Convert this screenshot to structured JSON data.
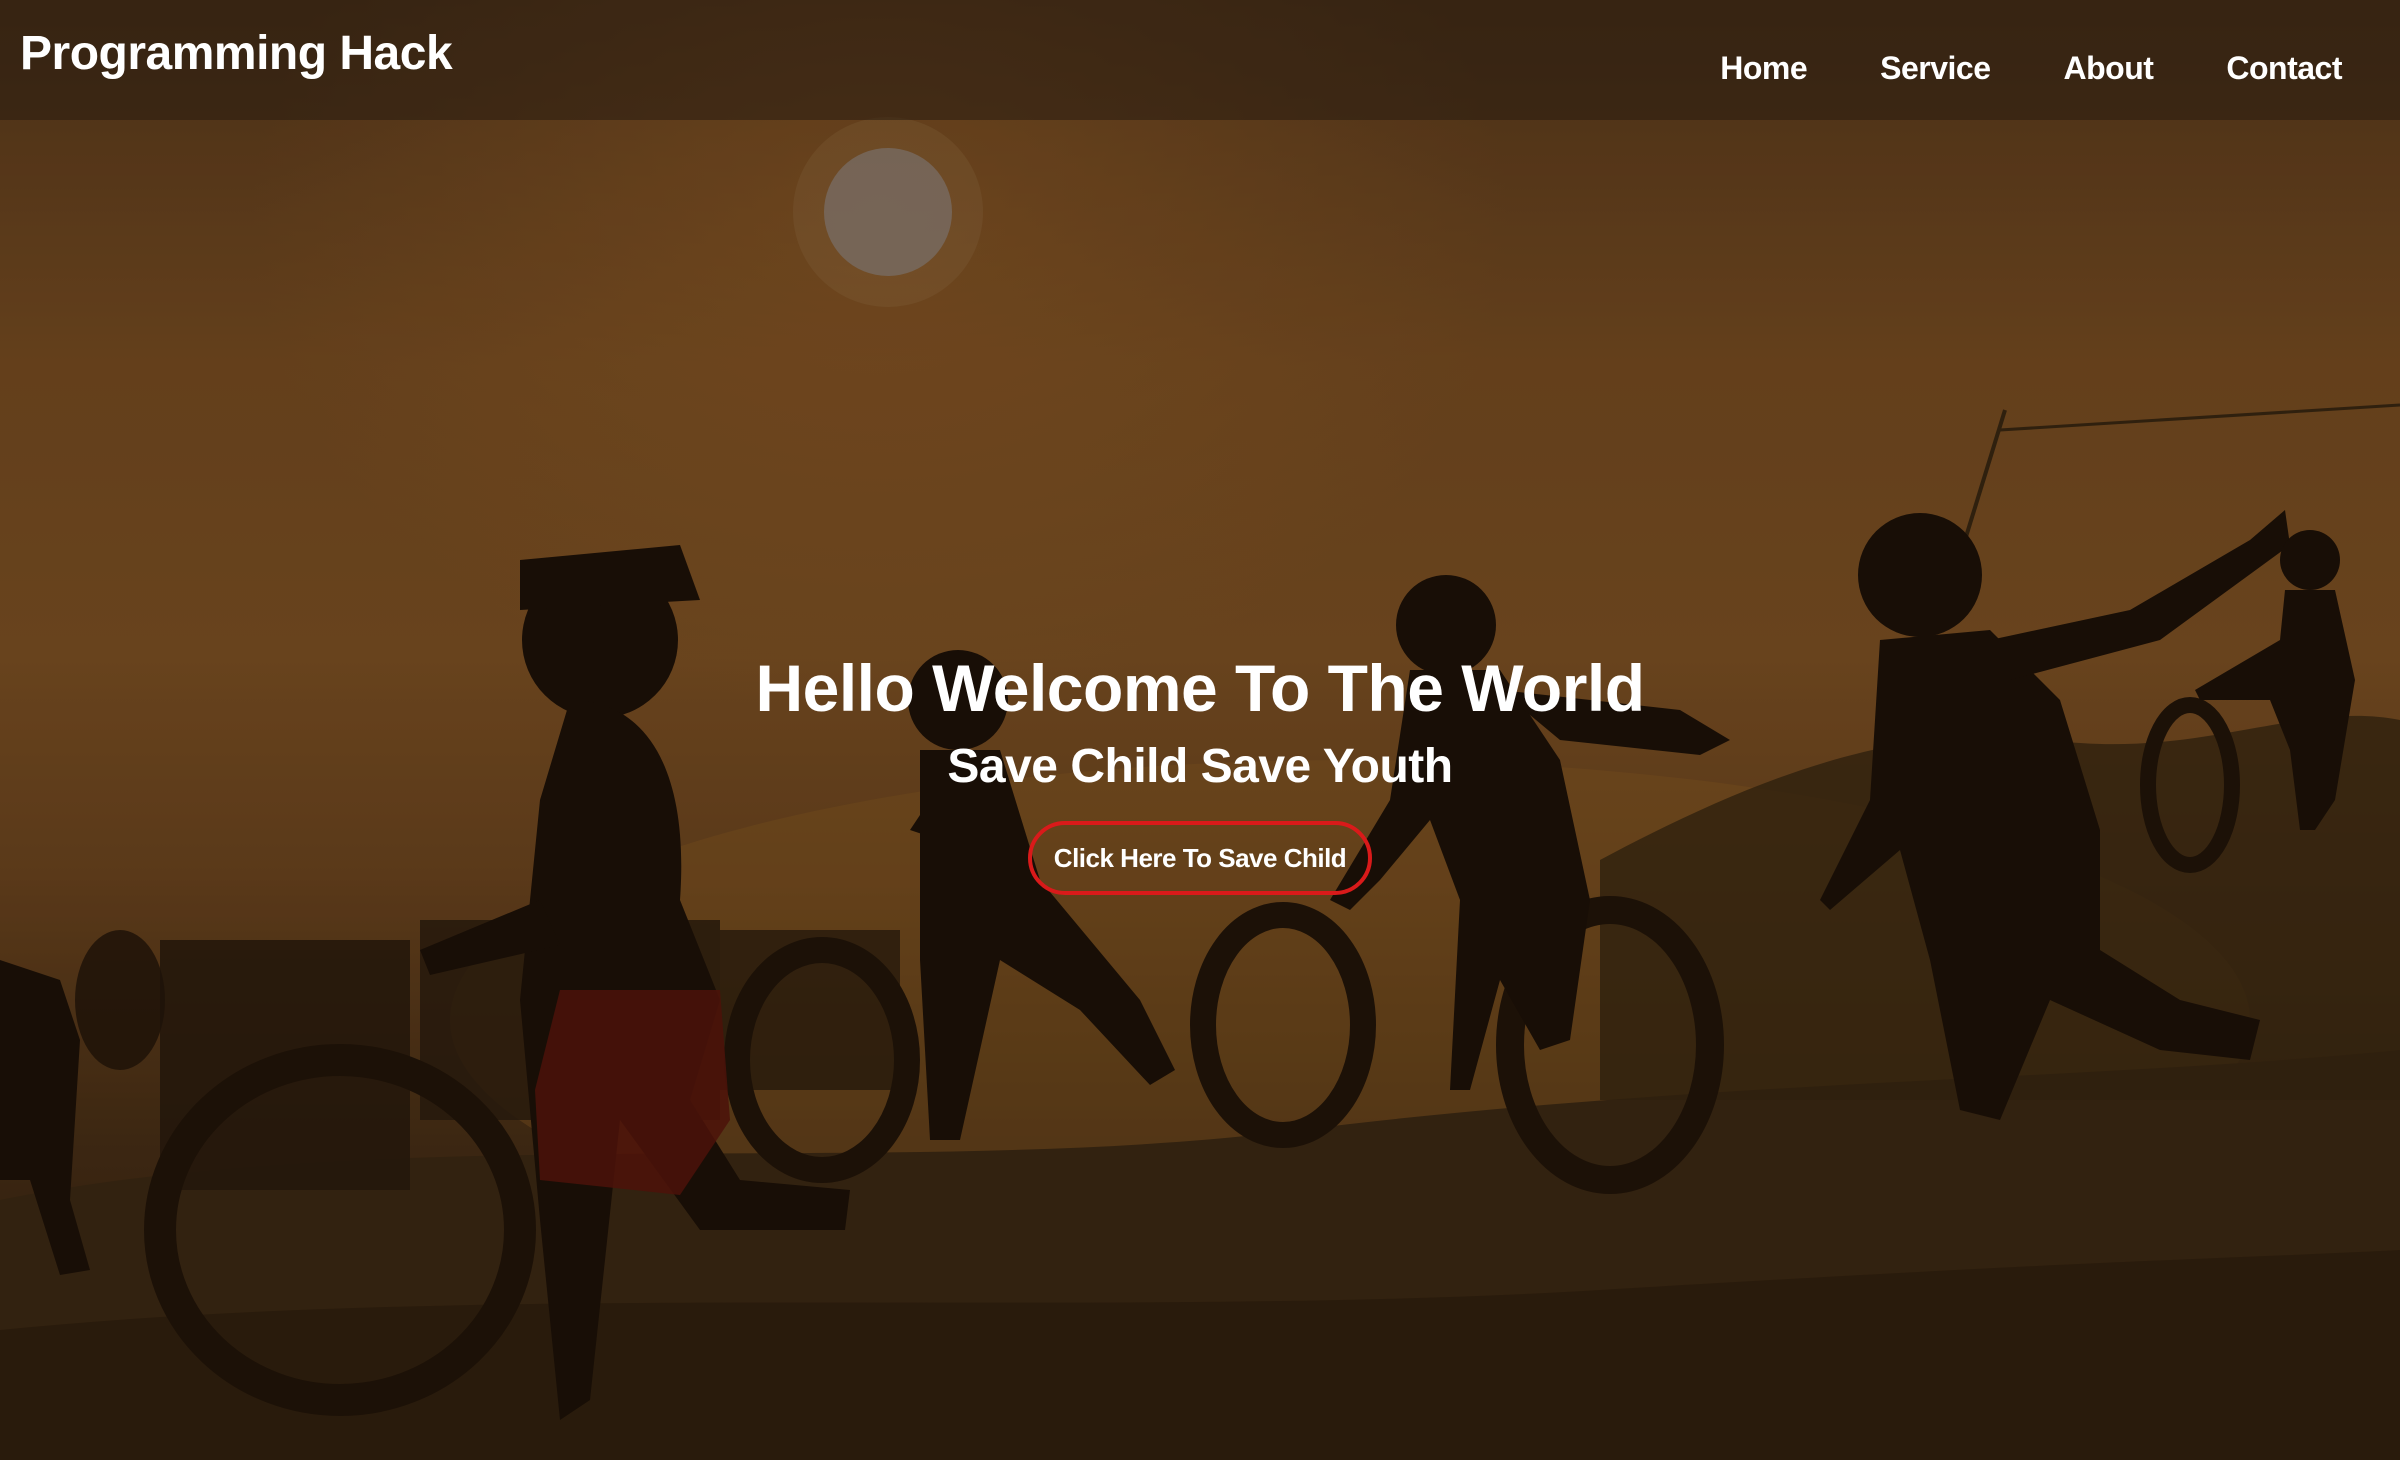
{
  "brand": {
    "title": "Programming Hack"
  },
  "nav": {
    "items": [
      {
        "label": "Home"
      },
      {
        "label": "Service"
      },
      {
        "label": "About"
      },
      {
        "label": "Contact"
      }
    ]
  },
  "hero": {
    "title": "Hello Welcome To The World",
    "subtitle": "Save Child Save Youth",
    "cta_label": "Click Here To Save Child",
    "background_image": "children-running-with-tires-silhouette"
  },
  "colors": {
    "text": "#ffffff",
    "cta_border": "#d91a1a",
    "navbar_bg": "#281c10"
  }
}
